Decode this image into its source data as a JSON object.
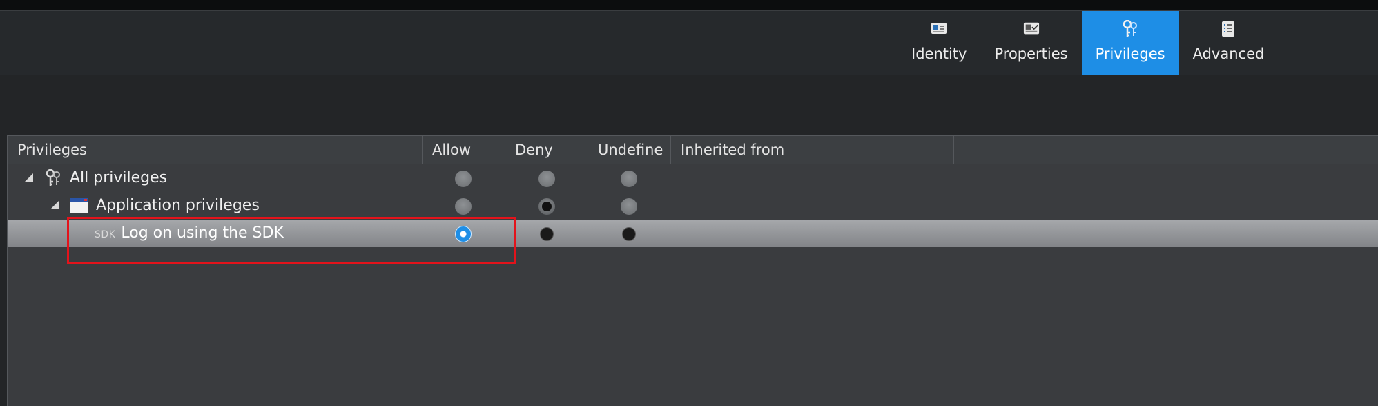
{
  "tabs": [
    {
      "label": "Identity",
      "icon": "identity-card-icon",
      "active": false
    },
    {
      "label": "Properties",
      "icon": "properties-icon",
      "active": false
    },
    {
      "label": "Privileges",
      "icon": "keys-icon",
      "active": true
    },
    {
      "label": "Advanced",
      "icon": "advanced-list-icon",
      "active": false
    }
  ],
  "table": {
    "columns": [
      "Privileges",
      "Allow",
      "Deny",
      "Undefine",
      "Inherited from"
    ],
    "rows": [
      {
        "label": "All privileges",
        "icon": "keys-icon",
        "expanded": true,
        "allow": "inactive",
        "deny": "inactive",
        "undefined": "inactive"
      },
      {
        "label": "Application privileges",
        "icon": "application-window-icon",
        "expanded": true,
        "allow": "inactive",
        "deny": "selected",
        "undefined": "inactive"
      },
      {
        "label": "Log on using the SDK",
        "icon_text": "SDK",
        "selected": true,
        "allow": "selected",
        "deny": "unselected",
        "undefined": "unselected"
      }
    ]
  },
  "colors": {
    "accent": "#1e8ee6",
    "highlight": "#e3131b"
  }
}
